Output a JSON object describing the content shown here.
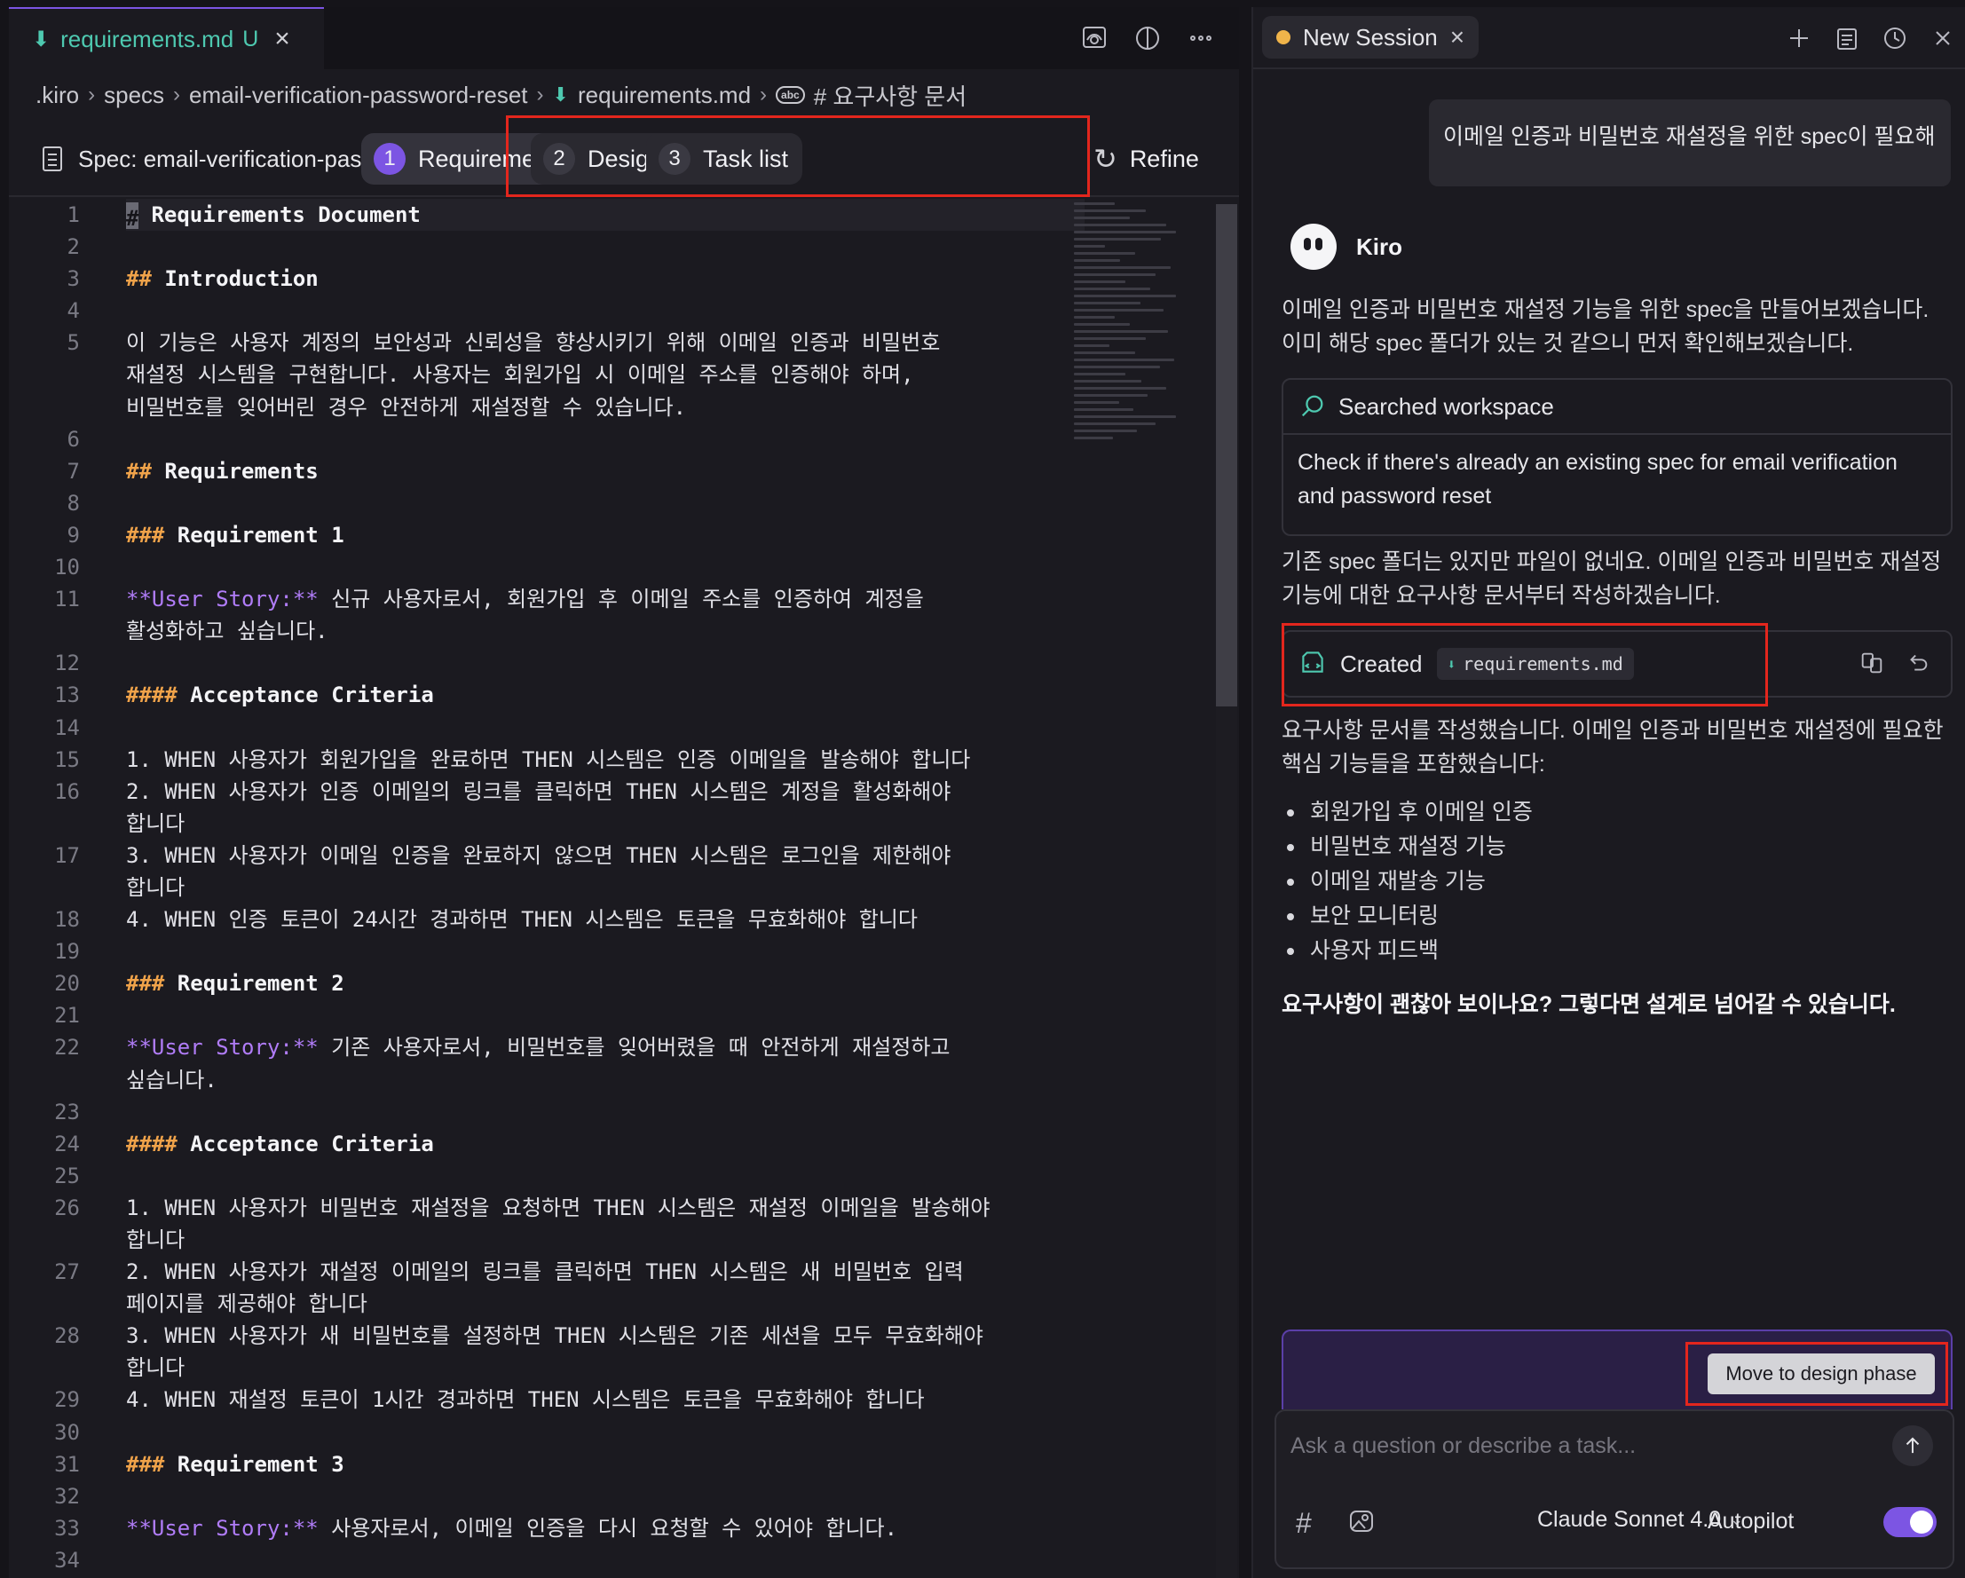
{
  "editor": {
    "tab": {
      "filename": "requirements.md",
      "status": "U"
    },
    "breadcrumb": [
      ".kiro",
      "specs",
      "email-verification-password-reset",
      "requirements.md",
      "# 요구사항 문서"
    ],
    "spec_label": "Spec: email-verification-password-reset",
    "steps": [
      {
        "num": "1",
        "label": "Requirements"
      },
      {
        "num": "2",
        "label": "Design"
      },
      {
        "num": "3",
        "label": "Task list"
      }
    ],
    "refine_label": "Refine",
    "lines": [
      {
        "n": "1",
        "type": "h",
        "hash": "#",
        "text": " Requirements Document"
      },
      {
        "n": "2",
        "type": "blank",
        "text": ""
      },
      {
        "n": "3",
        "type": "h",
        "hash": "##",
        "text": " Introduction"
      },
      {
        "n": "4",
        "type": "blank",
        "text": ""
      },
      {
        "n": "5",
        "type": "p",
        "text": "이 기능은 사용자 계정의 보안성과 신뢰성을 향상시키기 위해 이메일 인증과 비밀번호"
      },
      {
        "n": "",
        "type": "p",
        "text": "재설정 시스템을 구현합니다. 사용자는 회원가입 시 이메일 주소를 인증해야 하며,"
      },
      {
        "n": "",
        "type": "p",
        "text": "비밀번호를 잊어버린 경우 안전하게 재설정할 수 있습니다."
      },
      {
        "n": "6",
        "type": "blank",
        "text": ""
      },
      {
        "n": "7",
        "type": "h",
        "hash": "##",
        "text": " Requirements"
      },
      {
        "n": "8",
        "type": "blank",
        "text": ""
      },
      {
        "n": "9",
        "type": "h",
        "hash": "###",
        "text": " Requirement 1"
      },
      {
        "n": "10",
        "type": "blank",
        "text": ""
      },
      {
        "n": "11",
        "type": "story",
        "story": "**User Story:**",
        "text": " 신규 사용자로서, 회원가입 후 이메일 주소를 인증하여 계정을"
      },
      {
        "n": "",
        "type": "p",
        "text": "활성화하고 싶습니다."
      },
      {
        "n": "12",
        "type": "blank",
        "text": ""
      },
      {
        "n": "13",
        "type": "h",
        "hash": "####",
        "text": " Acceptance Criteria"
      },
      {
        "n": "14",
        "type": "blank",
        "text": ""
      },
      {
        "n": "15",
        "type": "p",
        "text": "1. WHEN 사용자가 회원가입을 완료하면 THEN 시스템은 인증 이메일을 발송해야 합니다"
      },
      {
        "n": "16",
        "type": "p",
        "text": "2. WHEN 사용자가 인증 이메일의 링크를 클릭하면 THEN 시스템은 계정을 활성화해야"
      },
      {
        "n": "",
        "type": "p",
        "text": "합니다"
      },
      {
        "n": "17",
        "type": "p",
        "text": "3. WHEN 사용자가 이메일 인증을 완료하지 않으면 THEN 시스템은 로그인을 제한해야"
      },
      {
        "n": "",
        "type": "p",
        "text": "합니다"
      },
      {
        "n": "18",
        "type": "p",
        "text": "4. WHEN 인증 토큰이 24시간 경과하면 THEN 시스템은 토큰을 무효화해야 합니다"
      },
      {
        "n": "19",
        "type": "blank",
        "text": ""
      },
      {
        "n": "20",
        "type": "h",
        "hash": "###",
        "text": " Requirement 2"
      },
      {
        "n": "21",
        "type": "blank",
        "text": ""
      },
      {
        "n": "22",
        "type": "story",
        "story": "**User Story:**",
        "text": " 기존 사용자로서, 비밀번호를 잊어버렸을 때 안전하게 재설정하고"
      },
      {
        "n": "",
        "type": "p",
        "text": "싶습니다."
      },
      {
        "n": "23",
        "type": "blank",
        "text": ""
      },
      {
        "n": "24",
        "type": "h",
        "hash": "####",
        "text": " Acceptance Criteria"
      },
      {
        "n": "25",
        "type": "blank",
        "text": ""
      },
      {
        "n": "26",
        "type": "p",
        "text": "1. WHEN 사용자가 비밀번호 재설정을 요청하면 THEN 시스템은 재설정 이메일을 발송해야"
      },
      {
        "n": "",
        "type": "p",
        "text": "합니다"
      },
      {
        "n": "27",
        "type": "p",
        "text": "2. WHEN 사용자가 재설정 이메일의 링크를 클릭하면 THEN 시스템은 새 비밀번호 입력"
      },
      {
        "n": "",
        "type": "p",
        "text": "페이지를 제공해야 합니다"
      },
      {
        "n": "28",
        "type": "p",
        "text": "3. WHEN 사용자가 새 비밀번호를 설정하면 THEN 시스템은 기존 세션을 모두 무효화해야"
      },
      {
        "n": "",
        "type": "p",
        "text": "합니다"
      },
      {
        "n": "29",
        "type": "p",
        "text": "4. WHEN 재설정 토큰이 1시간 경과하면 THEN 시스템은 토큰을 무효화해야 합니다"
      },
      {
        "n": "30",
        "type": "blank",
        "text": ""
      },
      {
        "n": "31",
        "type": "h",
        "hash": "###",
        "text": " Requirement 3"
      },
      {
        "n": "32",
        "type": "blank",
        "text": ""
      },
      {
        "n": "33",
        "type": "story",
        "story": "**User Story:**",
        "text": " 사용자로서, 이메일 인증을 다시 요청할 수 있어야 합니다."
      },
      {
        "n": "34",
        "type": "blank",
        "text": ""
      }
    ]
  },
  "chat": {
    "session_tab": "New Session",
    "user_message": "이메일 인증과 비밀번호 재설정을 위한 spec이 필요해",
    "assistant_name": "Kiro",
    "msg1": "이메일 인증과 비밀번호 재설정 기능을 위한 spec을 만들어보겠습니다. 이미 해당 spec 폴더가 있는 것 같으니 먼저 확인해보겠습니다.",
    "tool": {
      "title": "Searched workspace",
      "body": "Check if there's already an existing spec for email verification and password reset"
    },
    "msg2": "기존 spec 폴더는 있지만 파일이 없네요. 이메일 인증과 비밀번호 재설정 기능에 대한 요구사항 문서부터 작성하겠습니다.",
    "created": {
      "label": "Created",
      "file": "requirements.md"
    },
    "msg3": "요구사항 문서를 작성했습니다. 이메일 인증과 비밀번호 재설정에 필요한 핵심 기능들을 포함했습니다:",
    "bullets": [
      "회원가입 후 이메일 인증",
      "비밀번호 재설정 기능",
      "이메일 재발송 기능",
      "보안 모니터링",
      "사용자 피드백"
    ],
    "question": "요구사항이 괜찮아 보이나요? 그렇다면 설계로 넘어갈 수 있습니다.",
    "move_button": "Move to design phase",
    "input_placeholder": "Ask a question or describe a task...",
    "model": "Claude Sonnet 4.0",
    "autopilot_label": "Autopilot",
    "autopilot_on": true
  },
  "colors": {
    "accent": "#7c55e3",
    "highlight_box": "#e3261d",
    "markdown_file": "#4ec9b0",
    "heading_hash": "#f0a34a",
    "user_story": "#b07cf7"
  }
}
